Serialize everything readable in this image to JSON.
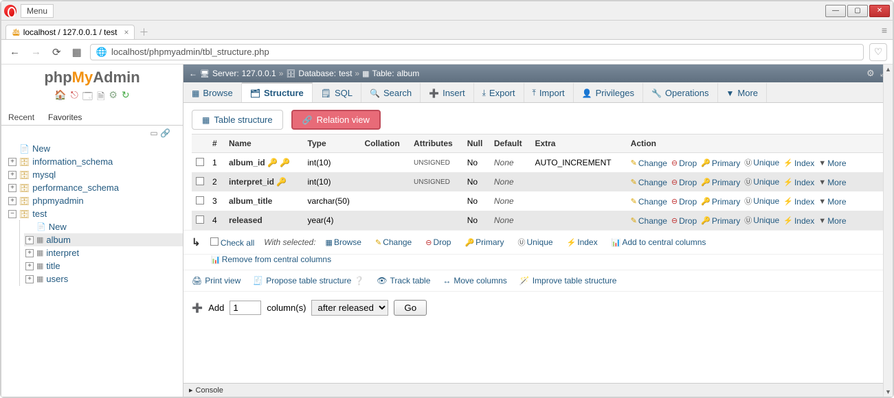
{
  "window": {
    "menu": "Menu"
  },
  "tab": {
    "title": "localhost / 127.0.0.1 / test"
  },
  "url": "localhost/phpmyadmin/tbl_structure.php",
  "logo": {
    "p1": "php",
    "p2": "My",
    "p3": "Admin"
  },
  "recent_favorites": {
    "recent": "Recent",
    "favorites": "Favorites"
  },
  "tree": {
    "new": "New",
    "dbs": [
      "information_schema",
      "mysql",
      "performance_schema",
      "phpmyadmin"
    ],
    "test": "test",
    "test_children_new": "New",
    "tables": [
      "album",
      "interpret",
      "title",
      "users"
    ]
  },
  "breadcrumb": {
    "server_lbl": "Server:",
    "server": "127.0.0.1",
    "db_lbl": "Database:",
    "db": "test",
    "table_lbl": "Table:",
    "table": "album"
  },
  "main_tabs": {
    "browse": "Browse",
    "structure": "Structure",
    "sql": "SQL",
    "search": "Search",
    "insert": "Insert",
    "export": "Export",
    "import": "Import",
    "privileges": "Privileges",
    "operations": "Operations",
    "more": "More"
  },
  "sub_tabs": {
    "table_structure": "Table structure",
    "relation_view": "Relation view"
  },
  "columns": {
    "headers": {
      "num": "#",
      "name": "Name",
      "type": "Type",
      "collation": "Collation",
      "attributes": "Attributes",
      "null": "Null",
      "default": "Default",
      "extra": "Extra",
      "action": "Action"
    },
    "rows": [
      {
        "num": "1",
        "name": "album_id",
        "type": "int(10)",
        "attributes": "UNSIGNED",
        "null": "No",
        "default": "None",
        "extra": "AUTO_INCREMENT",
        "pk": true,
        "idx": true
      },
      {
        "num": "2",
        "name": "interpret_id",
        "type": "int(10)",
        "attributes": "UNSIGNED",
        "null": "No",
        "default": "None",
        "extra": "",
        "idx": true
      },
      {
        "num": "3",
        "name": "album_title",
        "type": "varchar(50)",
        "attributes": "",
        "null": "No",
        "default": "None",
        "extra": ""
      },
      {
        "num": "4",
        "name": "released",
        "type": "year(4)",
        "attributes": "",
        "null": "No",
        "default": "None",
        "extra": ""
      }
    ],
    "actions": {
      "change": "Change",
      "drop": "Drop",
      "primary": "Primary",
      "unique": "Unique",
      "index": "Index",
      "more": "More"
    }
  },
  "bulk": {
    "check_all": "Check all",
    "with_selected": "With selected:",
    "browse": "Browse",
    "change": "Change",
    "drop": "Drop",
    "primary": "Primary",
    "unique": "Unique",
    "index": "Index",
    "add_central": "Add to central columns",
    "remove_central": "Remove from central columns"
  },
  "links": {
    "print": "Print view",
    "propose": "Propose table structure",
    "track": "Track table",
    "move": "Move columns",
    "improve": "Improve table structure"
  },
  "add": {
    "label": "Add",
    "count": "1",
    "unit": "column(s)",
    "position": "after released",
    "go": "Go"
  },
  "console": "Console"
}
